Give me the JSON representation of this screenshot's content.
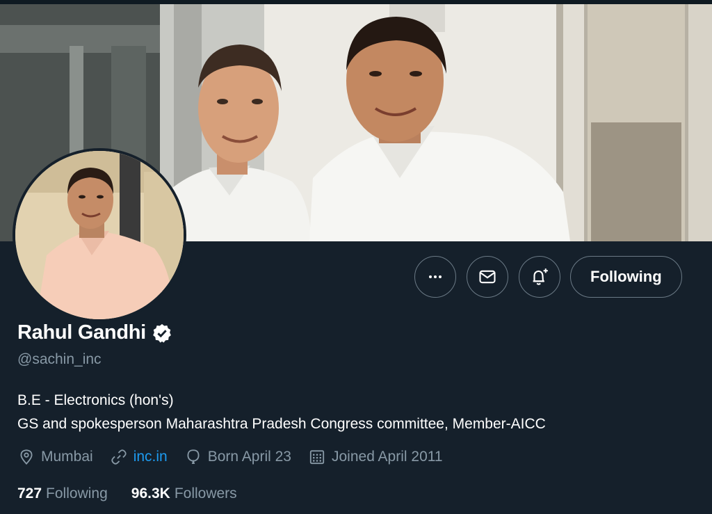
{
  "profile": {
    "name": "Rahul Gandhi",
    "handle": "@sachin_inc",
    "bio_lines": [
      "B.E - Electronics (hon's)",
      "GS and spokesperson Maharashtra Pradesh Congress committee, Member-AICC"
    ],
    "location": "Mumbai",
    "website": "inc.in",
    "birthday": "Born April 23",
    "joined": "Joined April 2011",
    "following_count": "727",
    "following_label": "Following",
    "followers_count": "96.3K",
    "followers_label": "Followers",
    "verified": true
  },
  "actions": {
    "more_icon": "more-horizontal-icon",
    "message_icon": "envelope-icon",
    "notify_icon": "bell-plus-icon",
    "follow_label": "Following"
  },
  "icons": {
    "location": "map-pin-icon",
    "website": "link-icon",
    "birthday": "balloon-icon",
    "joined": "calendar-icon",
    "verified": "verified-badge-icon"
  },
  "colors": {
    "background": "#15202b",
    "secondary_text": "#8899a6",
    "link": "#1d9bf0",
    "border": "#6b7a86"
  }
}
